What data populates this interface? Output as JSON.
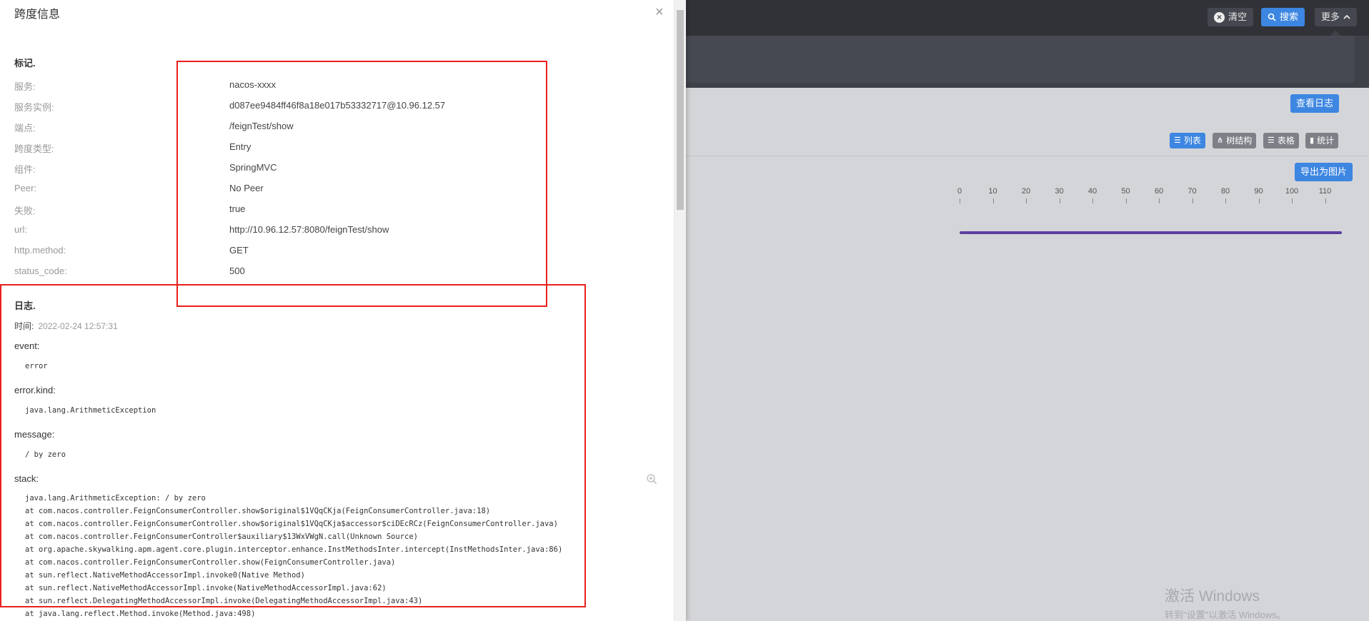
{
  "header": {
    "clear_label": "清空",
    "search_label": "搜索",
    "more_label": "更多"
  },
  "toolbar": {
    "view_log_label": "查看日志",
    "export_label": "导出为图片",
    "views": [
      {
        "label": "列表",
        "icon": "list-icon"
      },
      {
        "label": "树结构",
        "icon": "tree-icon"
      },
      {
        "label": "表格",
        "icon": "table-icon"
      },
      {
        "label": "统计",
        "icon": "stats-icon"
      }
    ]
  },
  "timeline": {
    "ticks": [
      "0",
      "10",
      "20",
      "30",
      "40",
      "50",
      "60",
      "70",
      "80",
      "90",
      "100",
      "110"
    ],
    "bar_color": "#5b3fa0"
  },
  "watermark": {
    "title": "激活 Windows",
    "subtitle": "转到\"设置\"以激活 Windows。"
  },
  "drawer": {
    "title": "跨度信息",
    "tags_title": "标记.",
    "tags": [
      {
        "key": "服务:",
        "value": "nacos-xxxx"
      },
      {
        "key": "服务实例:",
        "value": "d087ee9484ff46f8a18e017b53332717@10.96.12.57"
      },
      {
        "key": "端点:",
        "value": "/feignTest/show"
      },
      {
        "key": "跨度类型:",
        "value": "Entry"
      },
      {
        "key": "组件:",
        "value": "SpringMVC"
      },
      {
        "key": "Peer:",
        "value": "No Peer"
      },
      {
        "key": "失败:",
        "value": "true"
      },
      {
        "key": "url:",
        "value": "http://10.96.12.57:8080/feignTest/show"
      },
      {
        "key": "http.method:",
        "value": "GET"
      },
      {
        "key": "status_code:",
        "value": "500"
      }
    ],
    "logs_title": "日志.",
    "log": {
      "time_label": "时间:",
      "time_value": "2022-02-24 12:57:31",
      "event_label": "event:",
      "event_value": "error",
      "error_kind_label": "error.kind:",
      "error_kind_value": "java.lang.ArithmeticException",
      "message_label": "message:",
      "message_value": "/ by zero",
      "stack_label": "stack:",
      "stack": [
        "java.lang.ArithmeticException: / by zero",
        "at com.nacos.controller.FeignConsumerController.show$original$1VQqCKja(FeignConsumerController.java:18)",
        "at com.nacos.controller.FeignConsumerController.show$original$1VQqCKja$accessor$ciDEcRCz(FeignConsumerController.java)",
        "at com.nacos.controller.FeignConsumerController$auxiliary$13WxVWgN.call(Unknown Source)",
        "at org.apache.skywalking.apm.agent.core.plugin.interceptor.enhance.InstMethodsInter.intercept(InstMethodsInter.java:86)",
        "at com.nacos.controller.FeignConsumerController.show(FeignConsumerController.java)",
        "at sun.reflect.NativeMethodAccessorImpl.invoke0(Native Method)",
        "at sun.reflect.NativeMethodAccessorImpl.invoke(NativeMethodAccessorImpl.java:62)",
        "at sun.reflect.DelegatingMethodAccessorImpl.invoke(DelegatingMethodAccessorImpl.java:43)",
        "at java.lang.reflect.Method.invoke(Method.java:498)"
      ]
    }
  }
}
